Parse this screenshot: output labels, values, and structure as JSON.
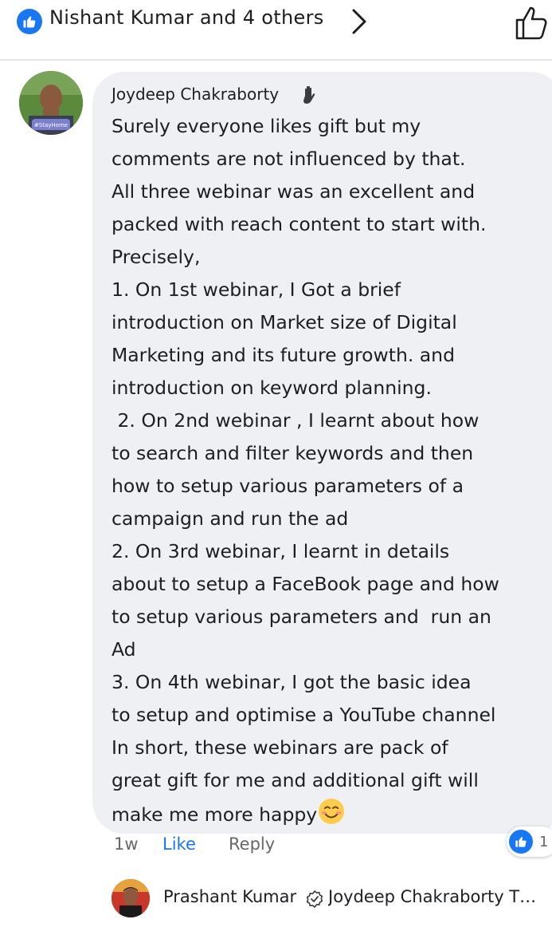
{
  "reactions": {
    "summary": "Nishant Kumar and 4 others",
    "like_icon": "like-icon",
    "chevron_icon": "chevron-right-icon",
    "thumb_icon": "thumbs-up-outline-icon"
  },
  "comment": {
    "author": "Joydeep Chakraborty",
    "author_badge_icon": "wave-hand-icon",
    "avatar_text": "#StayHome",
    "lines": [
      "Surely everyone likes gift but my",
      "comments are not influenced by that.",
      "All three webinar was an excellent and",
      "packed with reach content to start with.",
      "Precisely,",
      "1. On 1st webinar, I Got a brief",
      "introduction on Market size of Digital",
      "Marketing and its future growth. and",
      "introduction on keyword planning.",
      " 2. On 2nd webinar , I learnt about how",
      "to search and filter keywords and then",
      "how to setup various parameters of a",
      "campaign and run the ad",
      "2. On 3rd webinar, I learnt in details",
      "about to setup a FaceBook page and how",
      "to setup various parameters and  run an",
      "Ad",
      "3. On 4th webinar, I got the basic idea",
      "to setup and optimise a YouTube channel",
      "In short, these webinars are pack of",
      "great gift for me and additional gift will",
      "make me more happy"
    ],
    "emoji": "smiling-face-emoji",
    "time": "1w",
    "like_label": "Like",
    "reply_label": "Reply",
    "reaction_count": "1",
    "colors": {
      "accent": "#1877f2",
      "bubble": "#eff0f4",
      "muted": "#65676b"
    }
  },
  "reply": {
    "author": "Prashant Kumar",
    "verified_icon": "verified-badge-icon",
    "preview": "Joydeep Chakraborty Th…"
  }
}
